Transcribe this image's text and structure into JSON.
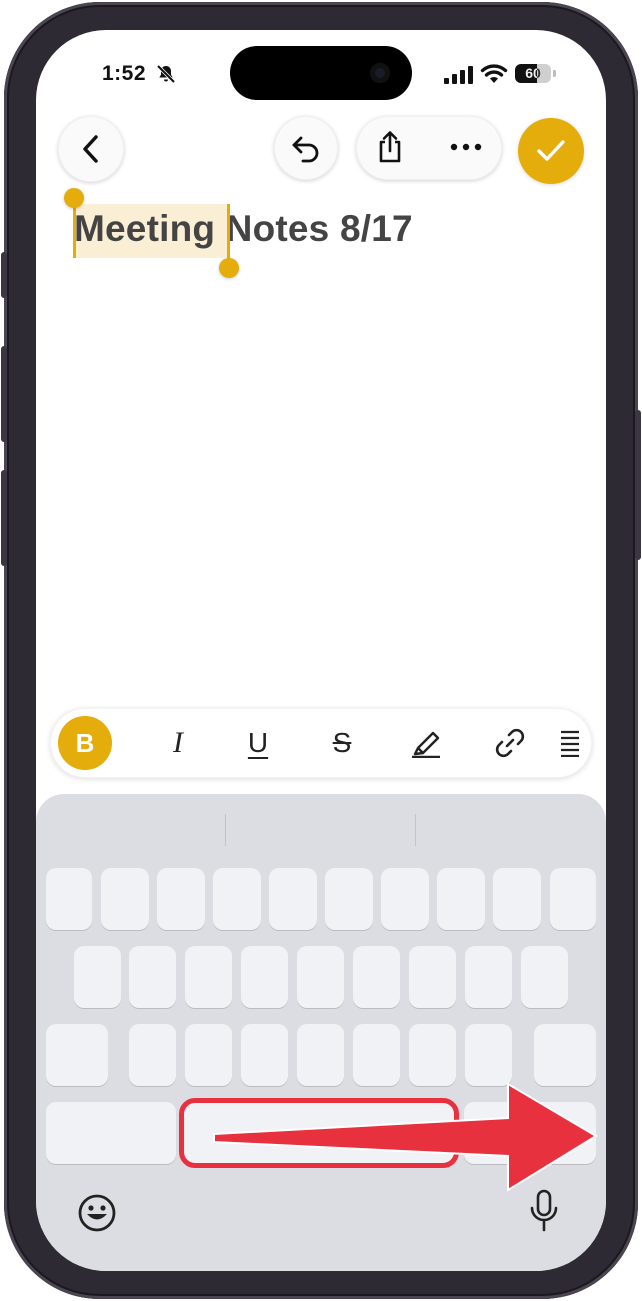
{
  "status_bar": {
    "time": "1:52",
    "battery": "60",
    "battery_level": 0.6
  },
  "icons": {
    "back": "chevron-left-icon",
    "undo": "undo-icon",
    "share": "share-icon",
    "more": "ellipsis-icon",
    "done": "checkmark-icon",
    "silent": "bell-slash-icon",
    "signal": "cellular-signal-icon",
    "wifi": "wifi-icon",
    "emoji": "emoji-icon",
    "mic": "microphone-icon"
  },
  "note": {
    "title_selected": "Meeting",
    "title_rest": " Notes 8/17"
  },
  "format_toolbar": {
    "bold": "B",
    "italic": "I",
    "underline": "U",
    "strikethrough": "S"
  },
  "colors": {
    "accent": "#e5ad0b",
    "annotation": "#e8313f",
    "keyboard_bg": "#dcdde3"
  }
}
